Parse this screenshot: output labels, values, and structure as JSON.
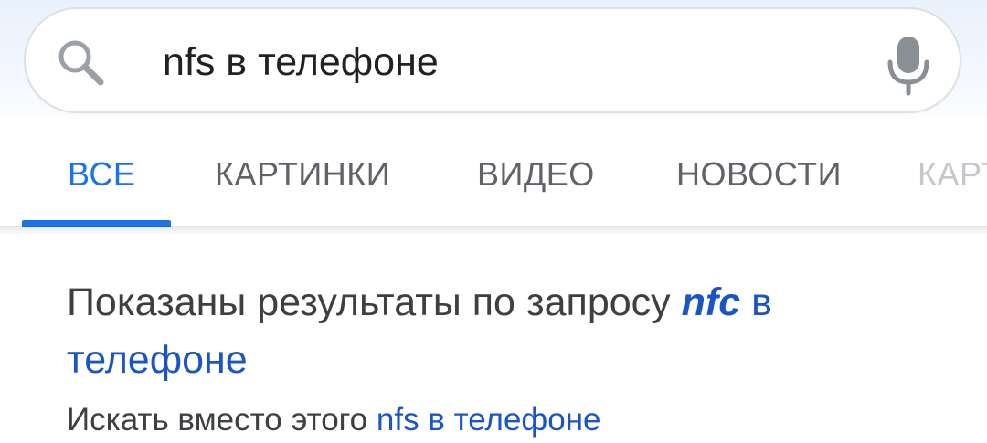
{
  "search": {
    "value": "nfs в телефоне"
  },
  "icons": {
    "search": "search-icon",
    "mic": "mic-icon"
  },
  "tabs": [
    {
      "label": "ВСЕ",
      "active": true
    },
    {
      "label": "КАРТИНКИ",
      "active": false
    },
    {
      "label": "ВИДЕО",
      "active": false
    },
    {
      "label": "НОВОСТИ",
      "active": false
    },
    {
      "label": "КАРТЫ",
      "active": false
    }
  ],
  "correction": {
    "showing_prefix": "Показаны результаты по запросу",
    "corrected_term": "nfc",
    "corrected_rest": " в телефоне",
    "instead_prefix": "Искать вместо этого",
    "original_query": "nfs в телефоне"
  },
  "colors": {
    "accent": "#1a73e8",
    "link": "#1a55c8",
    "text": "#3c4043",
    "muted": "#5f6368"
  }
}
